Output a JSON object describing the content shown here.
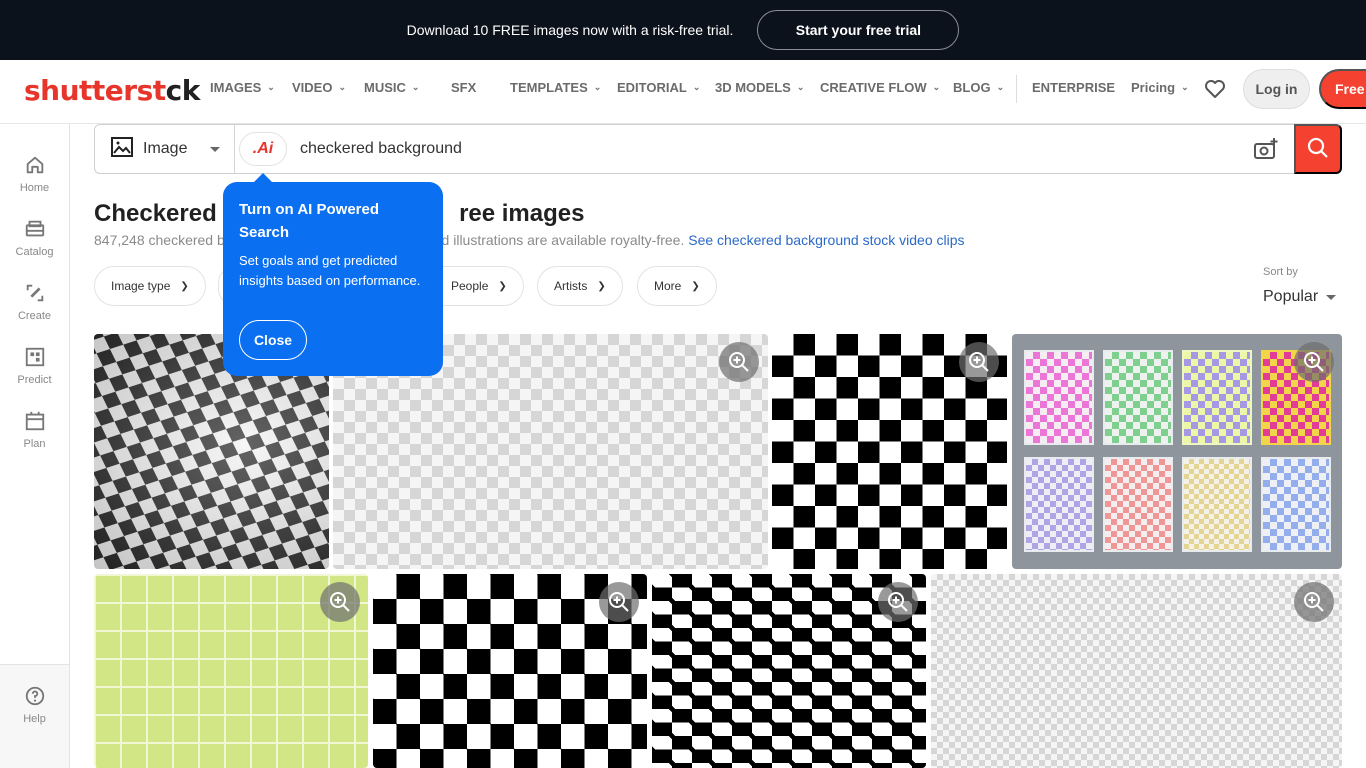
{
  "promo": {
    "text": "Download 10 FREE images now with a risk-free trial.",
    "cta": "Start your free trial"
  },
  "header": {
    "logo_part1": "shutterst",
    "logo_part2": "ck",
    "nav": [
      {
        "label": "IMAGES",
        "dropdown": true
      },
      {
        "label": "VIDEO",
        "dropdown": true
      },
      {
        "label": "MUSIC",
        "dropdown": true
      },
      {
        "label": "SFX",
        "dropdown": false
      },
      {
        "label": "TEMPLATES",
        "dropdown": true
      },
      {
        "label": "EDITORIAL",
        "dropdown": true
      },
      {
        "label": "3D MODELS",
        "dropdown": true
      },
      {
        "label": "CREATIVE FLOW",
        "dropdown": true
      },
      {
        "label": "BLOG",
        "dropdown": true
      },
      {
        "label": "ENTERPRISE",
        "dropdown": false
      },
      {
        "label": "Pricing",
        "dropdown": true
      }
    ],
    "chevron": "⌄",
    "login": "Log in",
    "free_trial": "Free t"
  },
  "sidebar": {
    "items": [
      {
        "label": "Home",
        "icon": "home-icon"
      },
      {
        "label": "Catalog",
        "icon": "catalog-icon"
      },
      {
        "label": "Create",
        "icon": "create-icon"
      },
      {
        "label": "Predict",
        "icon": "predict-icon"
      },
      {
        "label": "Plan",
        "icon": "plan-icon"
      }
    ],
    "help": "Help"
  },
  "search": {
    "type": "Image",
    "ai_label": ".Ai",
    "query": "checkered background"
  },
  "results": {
    "title": "Checkered background royalty-free images",
    "title_visible_start": "Checkered b",
    "title_visible_end": "ree images",
    "count_text": "847,248 checkered b",
    "desc_tail": "nd illustrations are available royalty-free. ",
    "video_link": "See checkered background stock video clips",
    "filters": [
      "Image type",
      "",
      "People",
      "Artists",
      "More"
    ],
    "sort_label": "Sort by",
    "sort_value": "Popular"
  },
  "tooltip": {
    "title": "Turn on AI Powered Search",
    "body": "Set goals and get predicted insights based on performance.",
    "close": "Close"
  },
  "tiles": [
    {
      "name": "wavy-checkered-flag"
    },
    {
      "name": "transparent-checker-pattern"
    },
    {
      "name": "black-white-checkerboard"
    },
    {
      "name": "colorful-wavy-checker-posters"
    },
    {
      "name": "green-grid-pattern"
    },
    {
      "name": "black-white-checkerboard-large"
    },
    {
      "name": "black-white-checkerboard-small"
    },
    {
      "name": "transparent-checker-pattern-2"
    }
  ],
  "colors": {
    "brand_red": "#f5412f",
    "tooltip_blue": "#0a6ff0",
    "promo_bg": "#0c121c",
    "link_blue": "#2b69c7"
  }
}
